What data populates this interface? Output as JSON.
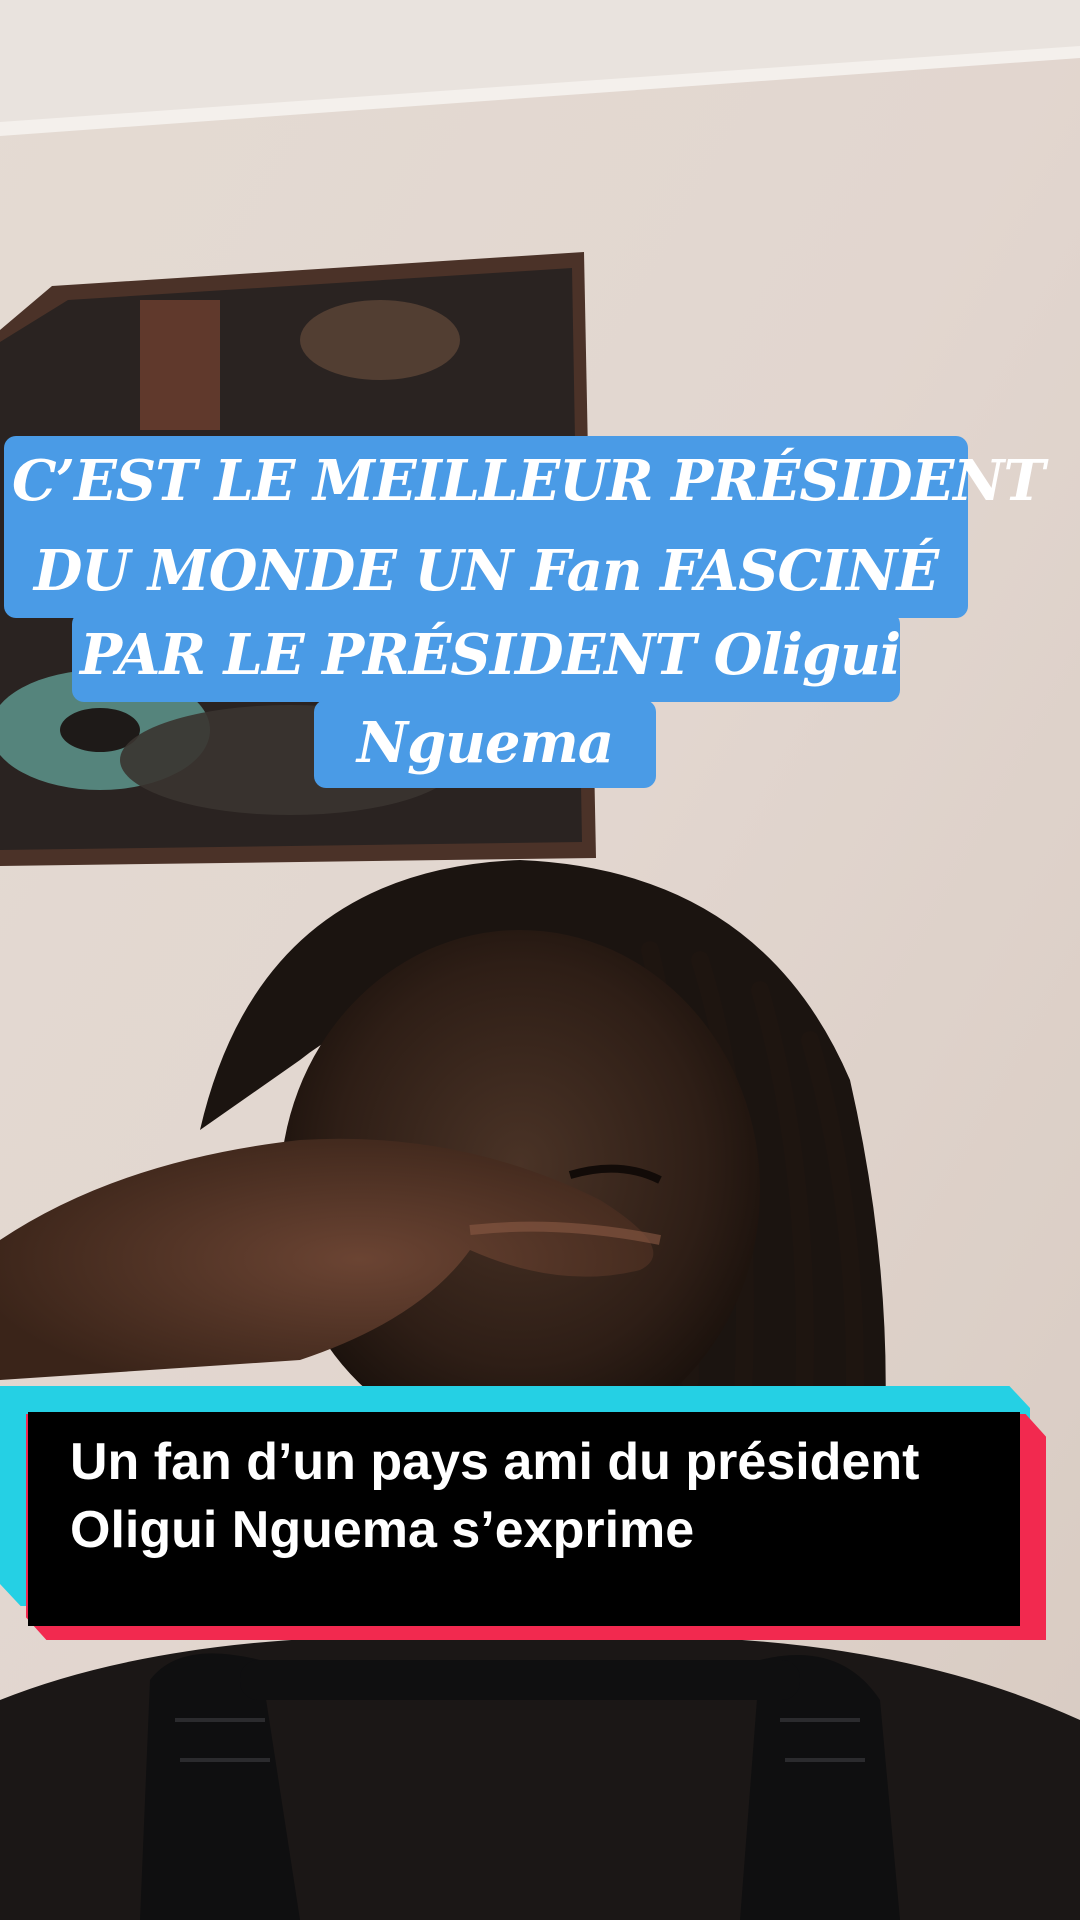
{
  "colors": {
    "caption_bg": "#4a9be6",
    "subtitle_accent_cyan": "#25d0e4",
    "subtitle_accent_red": "#f2294f"
  },
  "title_caption": {
    "line1": "C’EST LE MEILLEUR PRÉSIDENT",
    "line2": "DU MONDE UN Fan FASCINÉ",
    "line3": "PAR LE PRÉSIDENT Oligui",
    "line4": "Nguema"
  },
  "subtitle": {
    "line1": "Un fan d’un pays ami du président",
    "line2": "Oligui Nguema s’exprime"
  }
}
